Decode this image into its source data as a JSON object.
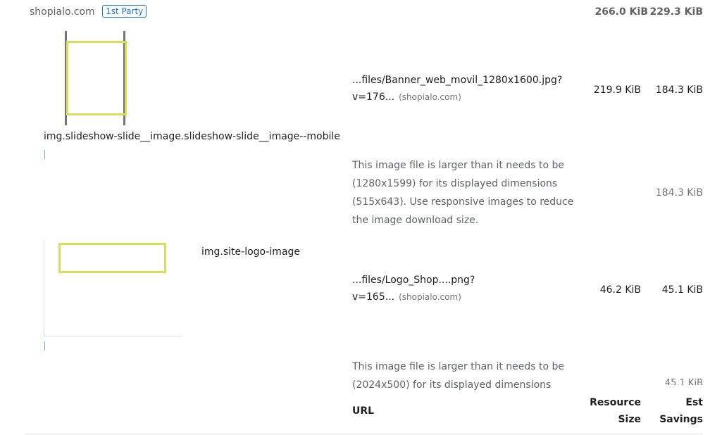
{
  "entity": {
    "name": "shopialo.com",
    "badge": "1st Party",
    "resource_size": "266.0 KiB",
    "est_savings": "229.3 KiB"
  },
  "items": [
    {
      "selector": "img.slideshow-slide__image.slideshow-slide__image--mobile",
      "url_line1": "...files/Banner_web_movil_1280x1600.jpg?",
      "url_line2": "v=176...",
      "host": "(shopialo.com)",
      "resource_size": "219.9 KiB",
      "est_savings": "184.3 KiB",
      "description": "This image file is larger than it needs to be (1280x1599) for its displayed dimensions (515x643). Use responsive images to reduce the image download size.",
      "sub_savings": "184.3 KiB"
    },
    {
      "selector": "img.site-logo-image",
      "url_line1": "...files/Logo_Shop....png?",
      "url_line2": "v=165...",
      "host": "(shopialo.com)",
      "resource_size": "46.2 KiB",
      "est_savings": "45.1 KiB",
      "description": "This image file is larger than it needs to be (2024x500) for its displayed dimensions",
      "sub_savings": "45.1 KiB"
    }
  ],
  "footer": {
    "url_header": "URL",
    "resource_header_1": "Resource",
    "resource_header_2": "Size",
    "savings_header_1": "Est",
    "savings_header_2": "Savings"
  }
}
